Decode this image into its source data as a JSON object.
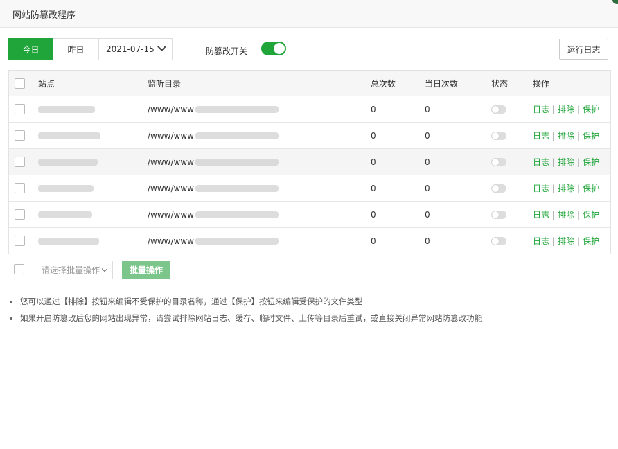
{
  "window": {
    "title": "网站防篡改程序"
  },
  "toolbar": {
    "today_label": "今日",
    "yesterday_label": "昨日",
    "date_value": "2021-07-15",
    "switch_label": "防篡改开关",
    "switch_on": true,
    "run_log_label": "运行日志"
  },
  "table": {
    "headers": [
      "站点",
      "监听目录",
      "总次数",
      "当日次数",
      "状态",
      "操作"
    ],
    "dir_prefix": "/www/www",
    "rows": [
      {
        "total": "0",
        "today": "0",
        "status_on": false
      },
      {
        "total": "0",
        "today": "0",
        "status_on": false
      },
      {
        "total": "0",
        "today": "0",
        "status_on": false
      },
      {
        "total": "0",
        "today": "0",
        "status_on": false
      },
      {
        "total": "0",
        "today": "0",
        "status_on": false
      },
      {
        "total": "0",
        "today": "0",
        "status_on": false
      }
    ],
    "actions": {
      "log": "日志",
      "exclude": "排除",
      "protect": "保护",
      "separator": "|"
    }
  },
  "footer": {
    "batch_select_placeholder": "请选择批量操作",
    "batch_button": "批量操作"
  },
  "notes": [
    "您可以通过【排除】按钮来编辑不受保护的目录名称，通过【保护】按钮来编辑受保护的文件类型",
    "如果开启防篡改后您的网站出现异常，请尝试排除网站日志、缓存、临时文件、上传等目录后重试，或直接关闭异常网站防篡改功能"
  ],
  "colors": {
    "accent": "#20a53a",
    "accent_light": "#7cc68b",
    "toggle_off": "#dddddd"
  }
}
